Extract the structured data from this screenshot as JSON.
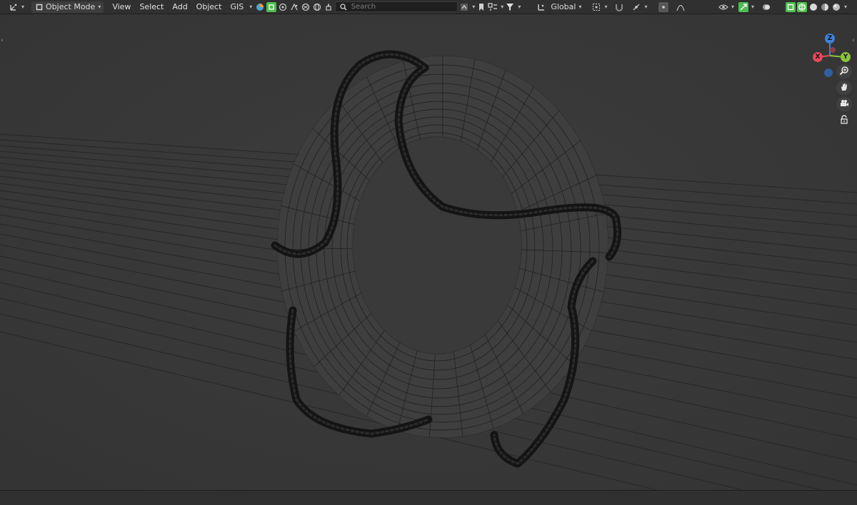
{
  "header": {
    "mode_label": "Object Mode",
    "menus": [
      "View",
      "Select",
      "Add",
      "Object",
      "GIS"
    ],
    "search_placeholder": "Search",
    "transform_orientation": "Global"
  },
  "gizmo": {
    "x_label": "X",
    "y_label": "Y",
    "z_label": "Z",
    "colors": {
      "x": "#e8485e",
      "y": "#8bc53a",
      "z": "#3d80d9",
      "neg": "#2f5f9e"
    }
  },
  "icons": {
    "editor_type": "axes-icon",
    "mode": "object-mode-icon",
    "search": "search-icon",
    "filter": "filter-icon",
    "zoom": "zoom-icon",
    "pan": "hand-icon",
    "camera": "camera-icon",
    "lock": "lock-icon"
  },
  "accent_colors": {
    "green": "#4fbd4f",
    "header_bg": "#303030",
    "viewport_bg": "#3a3a3a"
  }
}
